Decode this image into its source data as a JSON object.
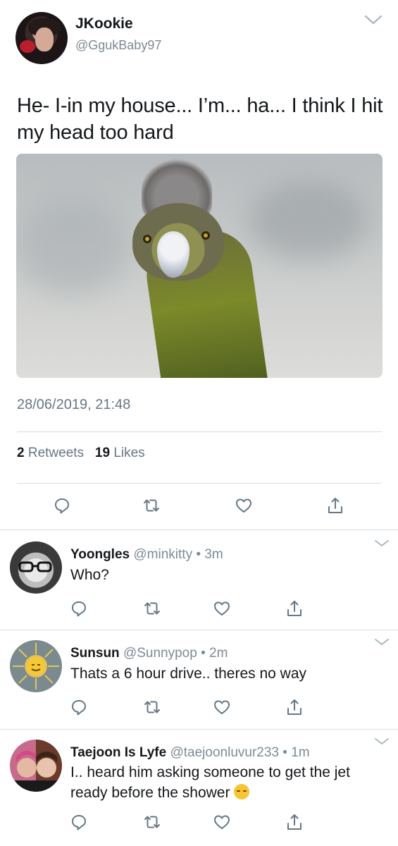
{
  "main_tweet": {
    "display_name": "JKookie",
    "handle": "@GgukBaby97",
    "text": "He- I-in my house... I’m... ha... I think I hit my head too hard",
    "timestamp": "28/06/2019, 21:48",
    "retweets_count": "2",
    "retweets_label": "Retweets",
    "likes_count": "19",
    "likes_label": "Likes",
    "photo_icon": "bird-photo"
  },
  "replies": [
    {
      "display_name": "Yoongles",
      "handle_meta": "@minkitty • 3m",
      "text": "Who?"
    },
    {
      "display_name": "Sunsun",
      "handle_meta": "@Sunnypop • 2m",
      "text": "Thats a 6 hour drive.. theres no way"
    },
    {
      "display_name": "Taejoon Is Lyfe",
      "handle_meta": "@taejoonluvur233 • 1m",
      "text": "I.. heard him asking someone to get the jet ready before the shower"
    }
  ],
  "icons": {
    "reply": "reply-icon",
    "retweet": "retweet-icon",
    "like": "heart-icon",
    "share": "share-icon",
    "more": "chevron-down-icon"
  },
  "colors": {
    "text": "#14171a",
    "secondary": "#657786",
    "divider": "#d8dde2"
  }
}
